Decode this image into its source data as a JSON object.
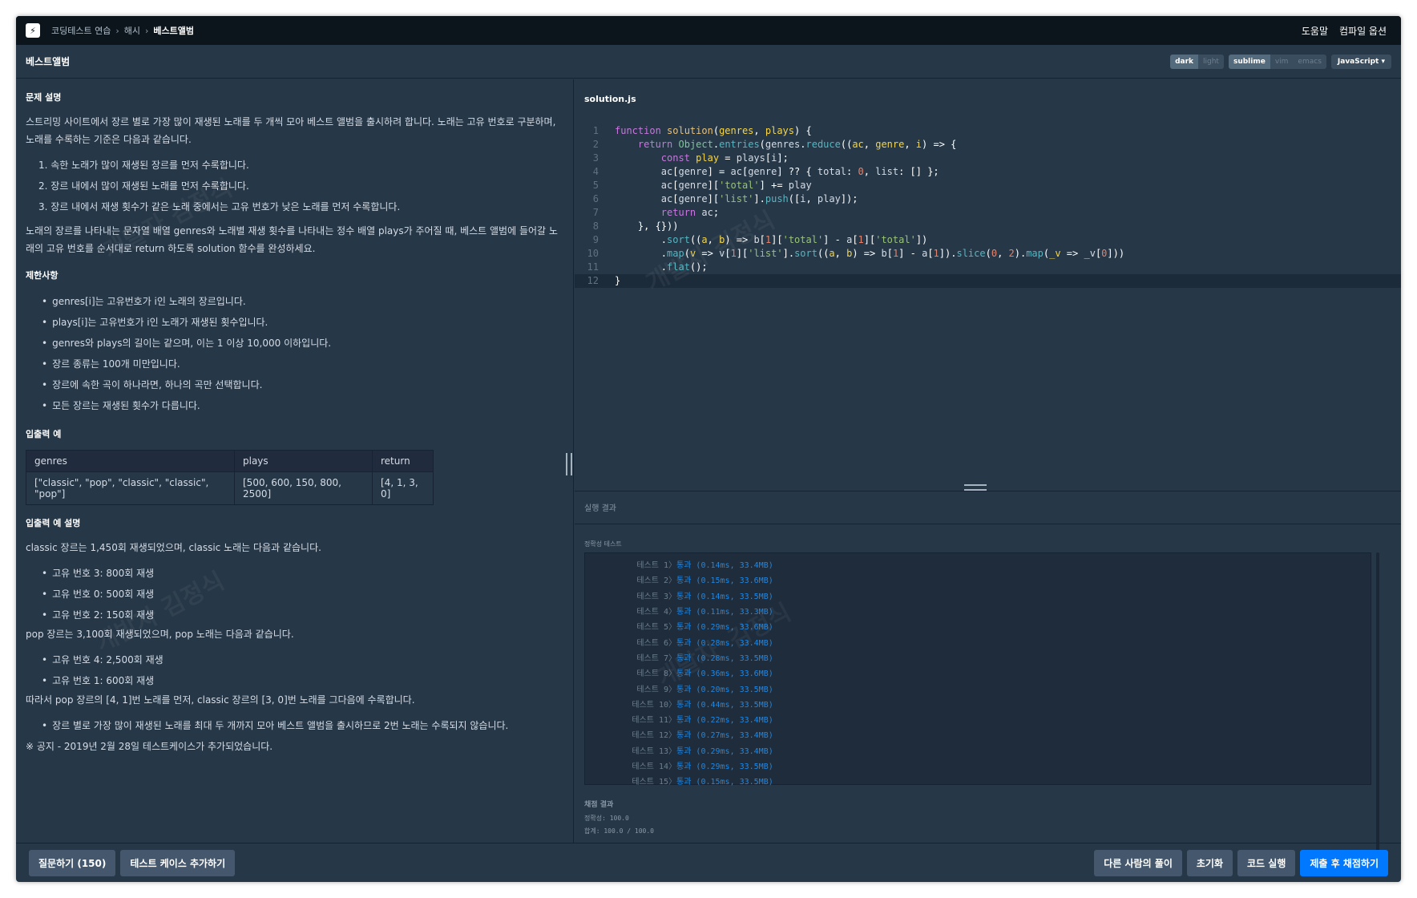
{
  "nav": {
    "logo": "⚡",
    "breadcrumb": [
      "코딩테스트 연습",
      "해시",
      "베스트앨범"
    ],
    "help": "도움말",
    "compile_options": "컴파일 옵션"
  },
  "titlebar": {
    "title": "베스트앨범",
    "themes": [
      "dark",
      "light"
    ],
    "keymaps": [
      "sublime",
      "vim",
      "emacs"
    ],
    "language": "JavaScript ▾"
  },
  "problem": {
    "section_desc": "문제 설명",
    "desc": "스트리밍 사이트에서 장르 별로 가장 많이 재생된 노래를 두 개씩 모아 베스트 앨범을 출시하려 합니다. 노래는 고유 번호로 구분하며, 노래를 수록하는 기준은 다음과 같습니다.",
    "rules": [
      "1. 속한 노래가 많이 재생된 장르를 먼저 수록합니다.",
      "2. 장르 내에서 많이 재생된 노래를 먼저 수록합니다.",
      "3. 장르 내에서 재생 횟수가 같은 노래 중에서는 고유 번호가 낮은 노래를 먼저 수록합니다."
    ],
    "task": "노래의 장르를 나타내는 문자열 배열 genres와 노래별 재생 횟수를 나타내는 정수 배열 plays가 주어질 때, 베스트 앨범에 들어갈 노래의 고유 번호를 순서대로 return 하도록 solution 함수를 완성하세요.",
    "section_limits": "제한사항",
    "limits": [
      "genres[i]는 고유번호가 i인 노래의 장르입니다.",
      "plays[i]는 고유번호가 i인 노래가 재생된 횟수입니다.",
      "genres와 plays의 길이는 같으며, 이는 1 이상 10,000 이하입니다.",
      "장르 종류는 100개 미만입니다.",
      "장르에 속한 곡이 하나라면, 하나의 곡만 선택합니다.",
      "모든 장르는 재생된 횟수가 다릅니다."
    ],
    "section_example": "입출력 예",
    "table_headers": [
      "genres",
      "plays",
      "return"
    ],
    "table_row": [
      "[\"classic\", \"pop\", \"classic\", \"classic\", \"pop\"]",
      "[500, 600, 150, 800, 2500]",
      "[4, 1, 3, 0]"
    ],
    "section_explain": "입출력 예 설명",
    "explain1": "classic 장르는 1,450회 재생되었으며, classic 노래는 다음과 같습니다.",
    "classic_list": [
      "고유 번호 3: 800회 재생",
      "고유 번호 0: 500회 재생",
      "고유 번호 2: 150회 재생"
    ],
    "explain2": "pop 장르는 3,100회 재생되었으며, pop 노래는 다음과 같습니다.",
    "pop_list": [
      "고유 번호 4: 2,500회 재생",
      "고유 번호 1: 600회 재생"
    ],
    "explain3": "따라서 pop 장르의 [4, 1]번 노래를 먼저, classic 장르의 [3, 0]번 노래를 그다음에 수록합니다.",
    "explain_list": [
      "장르 별로 가장 많이 재생된 노래를 최대 두 개까지 모아 베스트 앨범을 출시하므로 2번 노래는 수록되지 않습니다."
    ],
    "notice": "※ 공지 - 2019년 2월 28일 테스트케이스가 추가되었습니다."
  },
  "editor": {
    "filename": "solution.js",
    "line_numbers": [
      "1",
      "2",
      "3",
      "4",
      "5",
      "6",
      "7",
      "8",
      "9",
      "10",
      "11",
      "12"
    ]
  },
  "result": {
    "title": "실행 결과",
    "subtabs": "정확성  테스트",
    "tests": [
      {
        "label": "테스트 1",
        "result": "통과 (0.14ms, 33.4MB)"
      },
      {
        "label": "테스트 2",
        "result": "통과 (0.15ms, 33.6MB)"
      },
      {
        "label": "테스트 3",
        "result": "통과 (0.14ms, 33.5MB)"
      },
      {
        "label": "테스트 4",
        "result": "통과 (0.11ms, 33.3MB)"
      },
      {
        "label": "테스트 5",
        "result": "통과 (0.29ms, 33.6MB)"
      },
      {
        "label": "테스트 6",
        "result": "통과 (0.28ms, 33.4MB)"
      },
      {
        "label": "테스트 7",
        "result": "통과 (0.28ms, 33.5MB)"
      },
      {
        "label": "테스트 8",
        "result": "통과 (0.36ms, 33.6MB)"
      },
      {
        "label": "테스트 9",
        "result": "통과 (0.20ms, 33.5MB)"
      },
      {
        "label": "테스트 10",
        "result": "통과 (0.44ms, 33.5MB)"
      },
      {
        "label": "테스트 11",
        "result": "통과 (0.22ms, 33.4MB)"
      },
      {
        "label": "테스트 12",
        "result": "통과 (0.27ms, 33.4MB)"
      },
      {
        "label": "테스트 13",
        "result": "통과 (0.29ms, 33.4MB)"
      },
      {
        "label": "테스트 14",
        "result": "통과 (0.29ms, 33.5MB)"
      },
      {
        "label": "테스트 15",
        "result": "통과 (0.15ms, 33.5MB)"
      }
    ],
    "grading_title": "채점 결과",
    "accuracy": "정확성: 100.0",
    "total": "합계: 100.0 / 100.0"
  },
  "footer": {
    "question": "질문하기 (150)",
    "add_testcase": "테스트 케이스 추가하기",
    "others": "다른 사람의 풀이",
    "reset": "초기화",
    "run": "코드 실행",
    "submit": "제출 후 채점하기"
  },
  "watermark": "개발자 김정식"
}
